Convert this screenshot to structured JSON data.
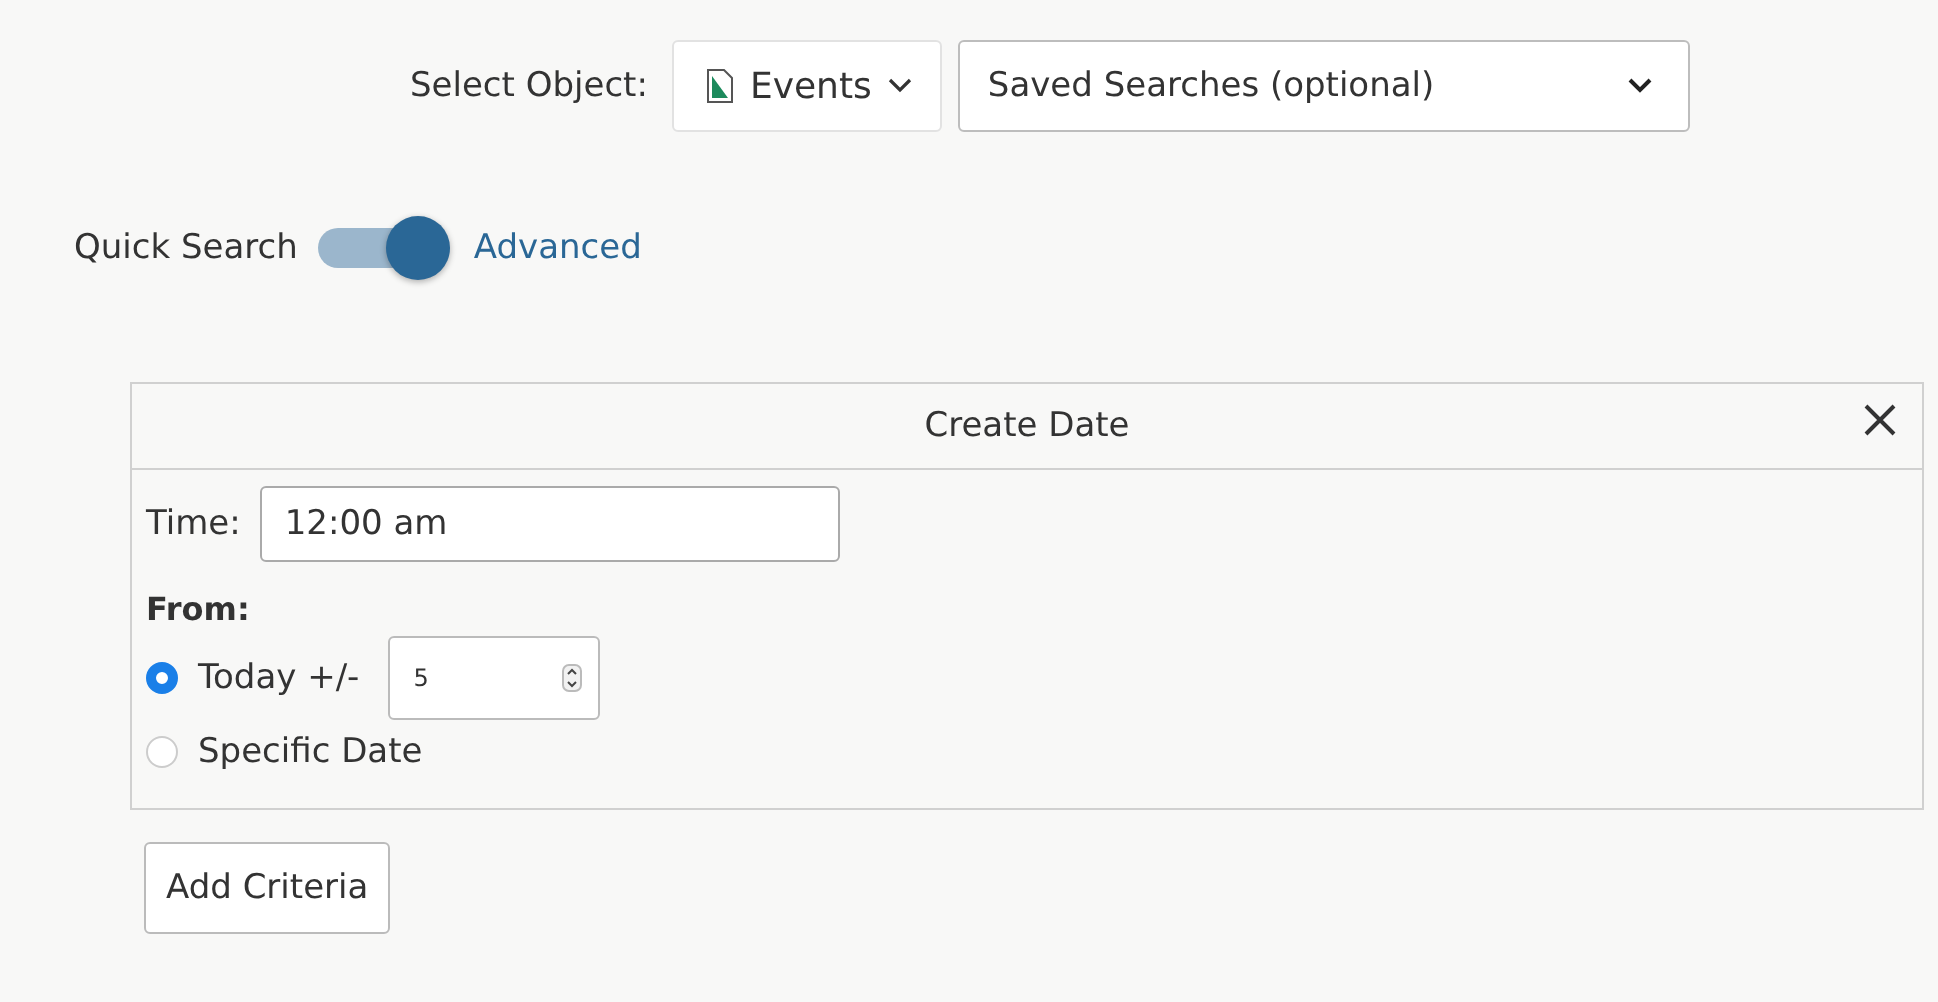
{
  "object_selector": {
    "label": "Select Object:",
    "value": "Events",
    "saved_searches": {
      "placeholder": "Saved Searches (optional)"
    }
  },
  "search_mode": {
    "left_label": "Quick Search",
    "right_label": "Advanced",
    "on": true
  },
  "criteria_panel": {
    "title": "Create Date",
    "time": {
      "label": "Time:",
      "value": "12:00 am"
    },
    "from_label": "From:",
    "options": [
      {
        "kind": "offset",
        "label": "Today +/-",
        "selected": true,
        "value": "5"
      },
      {
        "kind": "plain",
        "label": "Specific Date",
        "selected": false
      }
    ]
  },
  "add_button": "Add Criteria"
}
